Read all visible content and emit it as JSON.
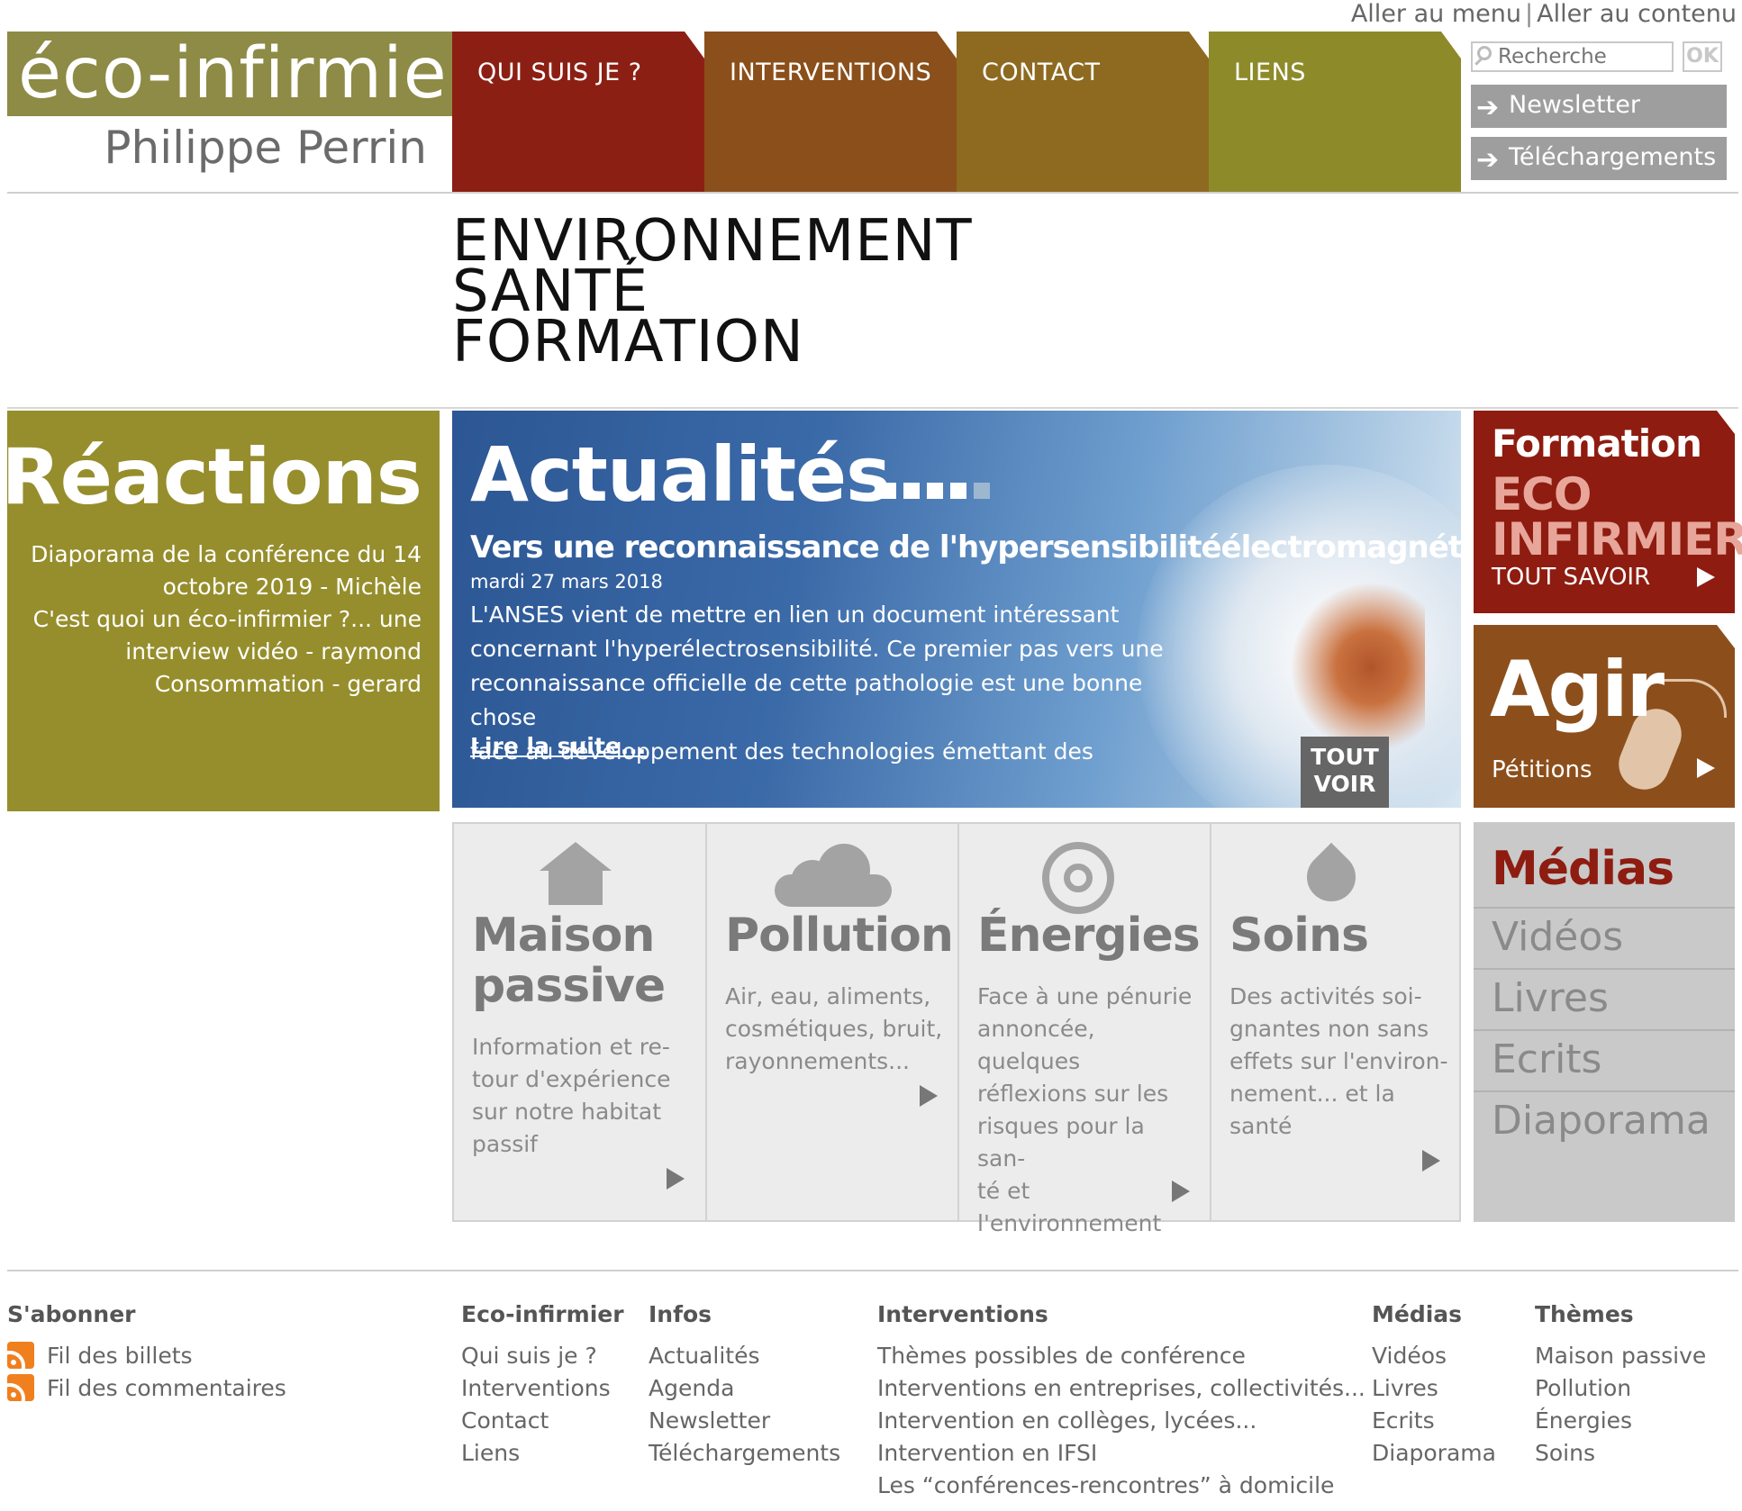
{
  "skip_links": {
    "menu": "Aller au menu",
    "separator": "|",
    "content": "Aller au contenu"
  },
  "logo": {
    "title": "éco-infirmier",
    "name": "Philippe Perrin"
  },
  "nav": [
    {
      "label": "QUI SUIS JE ?",
      "color": "#8c1f14"
    },
    {
      "label": "INTERVENTIONS",
      "color": "#8a4f1a"
    },
    {
      "label": "CONTACT",
      "color": "#8d6a20"
    },
    {
      "label": "LIENS",
      "color": "#8d8a2a"
    }
  ],
  "tools": {
    "search_placeholder": "Recherche",
    "search_ok": "OK",
    "newsletter": "Newsletter",
    "downloads": "Téléchargements",
    "arrow_icon": "arrow-right-icon"
  },
  "tagline": [
    "ENVIRONNEMENT",
    "SANTÉ",
    "FORMATION"
  ],
  "reactions": {
    "title": "Réactions",
    "lines": [
      "Diaporama de la conférence du 14",
      "octobre 2019 - Michèle",
      "C'est quoi un éco-infirmier ?... une",
      "interview vidéo - raymond",
      "Consommation - gerard"
    ]
  },
  "actualites": {
    "title": "Actualités",
    "headline": "Vers une reconnaissance de l'hypersensibilitéélectromagnétique ?",
    "date": "mardi 27 mars 2018",
    "body": [
      "L'ANSES vient de mettre en lien un document intéressant",
      "concernant l'hyperélectrosensibilité. Ce premier pas vers une",
      "reconnaissance officielle de cette pathologie est une bonne chose",
      "face au développement des technologies émettant des"
    ],
    "read_more": "Lire la suite...",
    "see_all": [
      "TOUT",
      "VOIR"
    ]
  },
  "formation": {
    "line1": "Formation",
    "line2": "ECO",
    "line3": "INFIRMIER",
    "link": "TOUT SAVOIR"
  },
  "agir": {
    "title": "Agir",
    "link": "Pétitions"
  },
  "themes": [
    {
      "title": [
        "Maison",
        "passive"
      ],
      "desc": [
        "Information et re-",
        "tour d'expérience",
        "sur notre habitat",
        "passif"
      ],
      "icon": "house-icon"
    },
    {
      "title": [
        "Pollution"
      ],
      "desc": [
        "Air, eau, aliments,",
        "cosmétiques, bruit,",
        "rayonnements..."
      ],
      "icon": "cloud-icon"
    },
    {
      "title": [
        "Énergies"
      ],
      "desc": [
        "Face à une pénurie",
        "annoncée, quelques",
        "réflexions sur les",
        "risques pour la san-",
        "té et",
        "l'environnement"
      ],
      "icon": "target-icon"
    },
    {
      "title": [
        "Soins"
      ],
      "desc": [
        "Des activités soi-",
        "gnantes non sans",
        "effets sur l'environ-",
        "nement... et la",
        "santé"
      ],
      "icon": "drop-icon"
    }
  ],
  "medias": {
    "title": "Médias",
    "items": [
      "Vidéos",
      "Livres",
      "Ecrits",
      "Diaporama"
    ]
  },
  "footer": {
    "subscribe": {
      "title": "S'abonner",
      "items": [
        "Fil des billets",
        "Fil des commentaires"
      ]
    },
    "eco": {
      "title": "Eco-infirmier",
      "items": [
        "Qui suis je ?",
        "Interventions",
        "Contact",
        "Liens"
      ]
    },
    "infos": {
      "title": "Infos",
      "items": [
        "Actualités",
        "Agenda",
        "Newsletter",
        "Téléchargements"
      ]
    },
    "interventions": {
      "title": "Interventions",
      "items": [
        "Thèmes possibles de conférence",
        "Interventions en entreprises, collectivités...",
        "Intervention en collèges, lycées...",
        "Intervention en IFSI",
        "Les “conférences-rencontres” à domicile"
      ]
    },
    "medias": {
      "title": "Médias",
      "items": [
        "Vidéos",
        "Livres",
        "Ecrits",
        "Diaporama"
      ]
    },
    "themes": {
      "title": "Thèmes",
      "items": [
        "Maison passive",
        "Pollution",
        "Énergies",
        "Soins"
      ]
    }
  }
}
